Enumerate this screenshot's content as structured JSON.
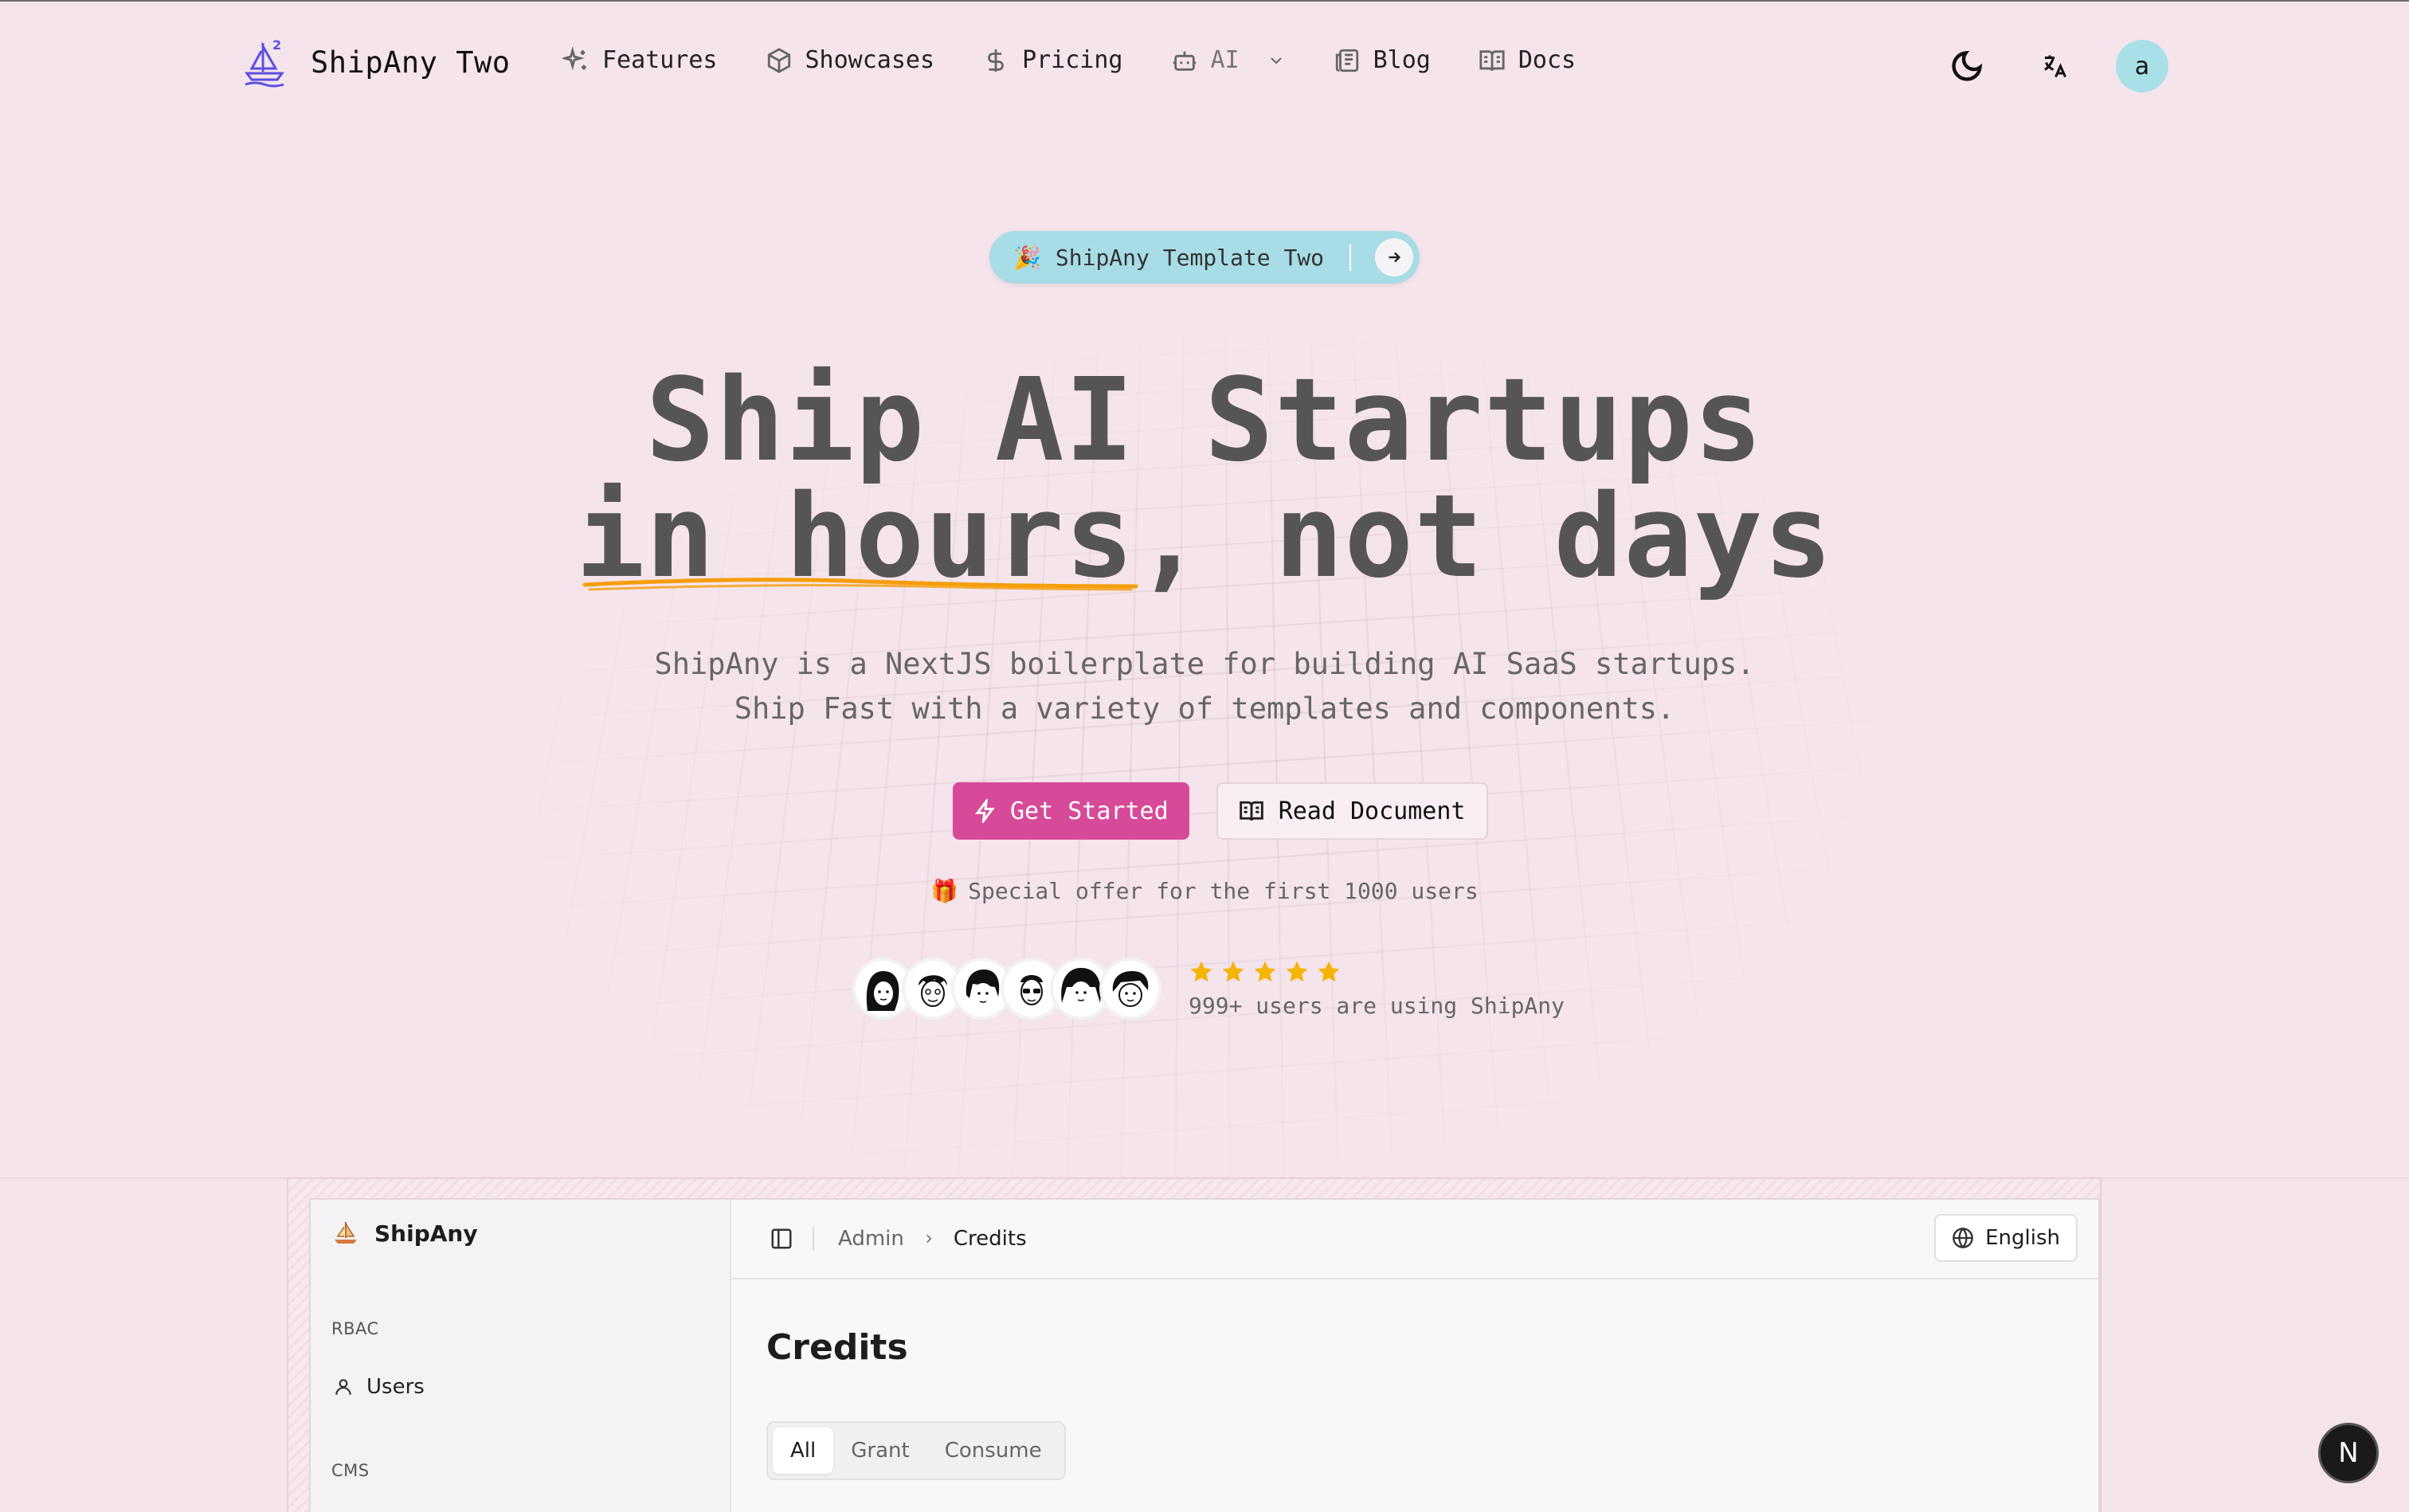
{
  "header": {
    "brand": "ShipAny Two",
    "nav": [
      {
        "label": "Features",
        "icon": "sparkles-icon"
      },
      {
        "label": "Showcases",
        "icon": "box-icon"
      },
      {
        "label": "Pricing",
        "icon": "dollar-icon"
      },
      {
        "label": "AI",
        "icon": "bot-icon"
      },
      {
        "label": "Blog",
        "icon": "newspaper-icon"
      },
      {
        "label": "Docs",
        "icon": "book-icon"
      }
    ],
    "avatar_initial": "a"
  },
  "hero": {
    "badge": "ShipAny Template Two",
    "title_line1": "Ship AI Startups",
    "title_line2": "in hours, not days",
    "subtitle_line1": "ShipAny is a NextJS boilerplate for building AI SaaS startups.",
    "subtitle_line2": "Ship Fast with a variety of templates and components.",
    "primary_cta": "Get Started",
    "secondary_cta": "Read Document",
    "offer": "Special offer for the first 1000 users",
    "rating_stars": 5,
    "rating_text": "999+ users are using ShipAny"
  },
  "preview": {
    "sidebar_brand": "ShipAny",
    "groups": [
      "RBAC",
      "CMS"
    ],
    "sidebar_items": [
      {
        "label": "Users"
      }
    ],
    "breadcrumb": [
      "Admin",
      "Credits"
    ],
    "language": "English",
    "page_title": "Credits",
    "tabs": [
      "All",
      "Grant",
      "Consume"
    ]
  },
  "colors": {
    "background": "#f5e4ec",
    "primary": "#d64a99",
    "badge": "#a8dce6",
    "underline": "#f59e0b",
    "star": "#f5b400",
    "avatar": "#a9e0e8"
  },
  "framework_badge": "N"
}
